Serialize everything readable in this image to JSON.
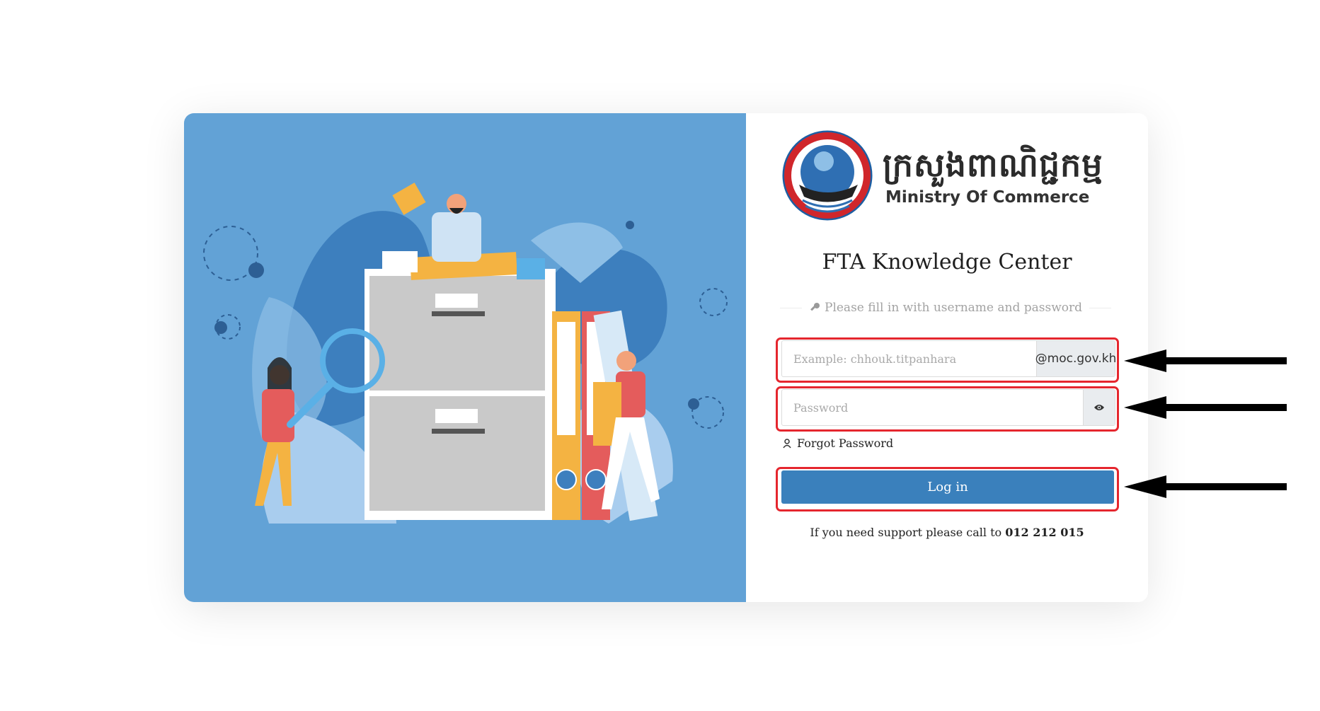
{
  "brand": {
    "name_kh": "ក្រសួងពាណិជ្ជកម្ម",
    "name_en": "Ministry Of Commerce",
    "seal_text": "MINISTRY OF COMMERCE"
  },
  "login": {
    "title": "FTA Knowledge Center",
    "hint": "Please fill in with username and password",
    "username_placeholder": "Example: chhouk.titpanhara",
    "username_value": "",
    "domain_suffix": "@moc.gov.kh",
    "password_placeholder": "Password",
    "password_value": "",
    "forgot_label": "Forgot Password",
    "login_label": "Log in",
    "support_text": "If you need support please call to",
    "support_phone": "012 212 015"
  },
  "colors": {
    "illustration_bg": "#62a2d6",
    "primary_button": "#3a80bc",
    "highlight": "#e5262e"
  },
  "icons": [
    "key-icon",
    "eye-icon",
    "user-icon",
    "arrow-left-icon"
  ]
}
